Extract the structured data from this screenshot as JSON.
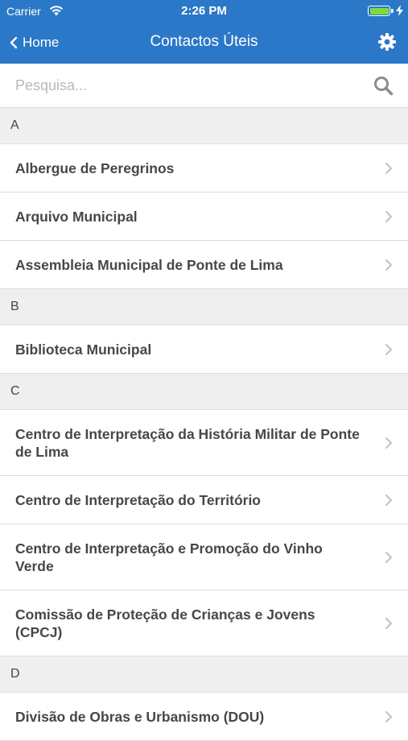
{
  "status": {
    "carrier": "Carrier",
    "time": "2:26 PM"
  },
  "nav": {
    "back_label": "Home",
    "title": "Contactos Úteis"
  },
  "search": {
    "placeholder": "Pesquisa..."
  },
  "sections": [
    {
      "letter": "A",
      "items": [
        "Albergue de Peregrinos",
        "Arquivo Municipal",
        "Assembleia Municipal de Ponte de Lima"
      ]
    },
    {
      "letter": "B",
      "items": [
        "Biblioteca Municipal"
      ]
    },
    {
      "letter": "C",
      "items": [
        "Centro de Interpretação da História Militar de Ponte de Lima",
        "Centro de Interpretação do Território",
        "Centro de Interpretação e Promoção do Vinho Verde",
        "Comissão de Proteção de Crianças e Jovens (CPCJ)"
      ]
    },
    {
      "letter": "D",
      "items": [
        "Divisão de Obras e Urbanismo (DOU)"
      ]
    }
  ]
}
